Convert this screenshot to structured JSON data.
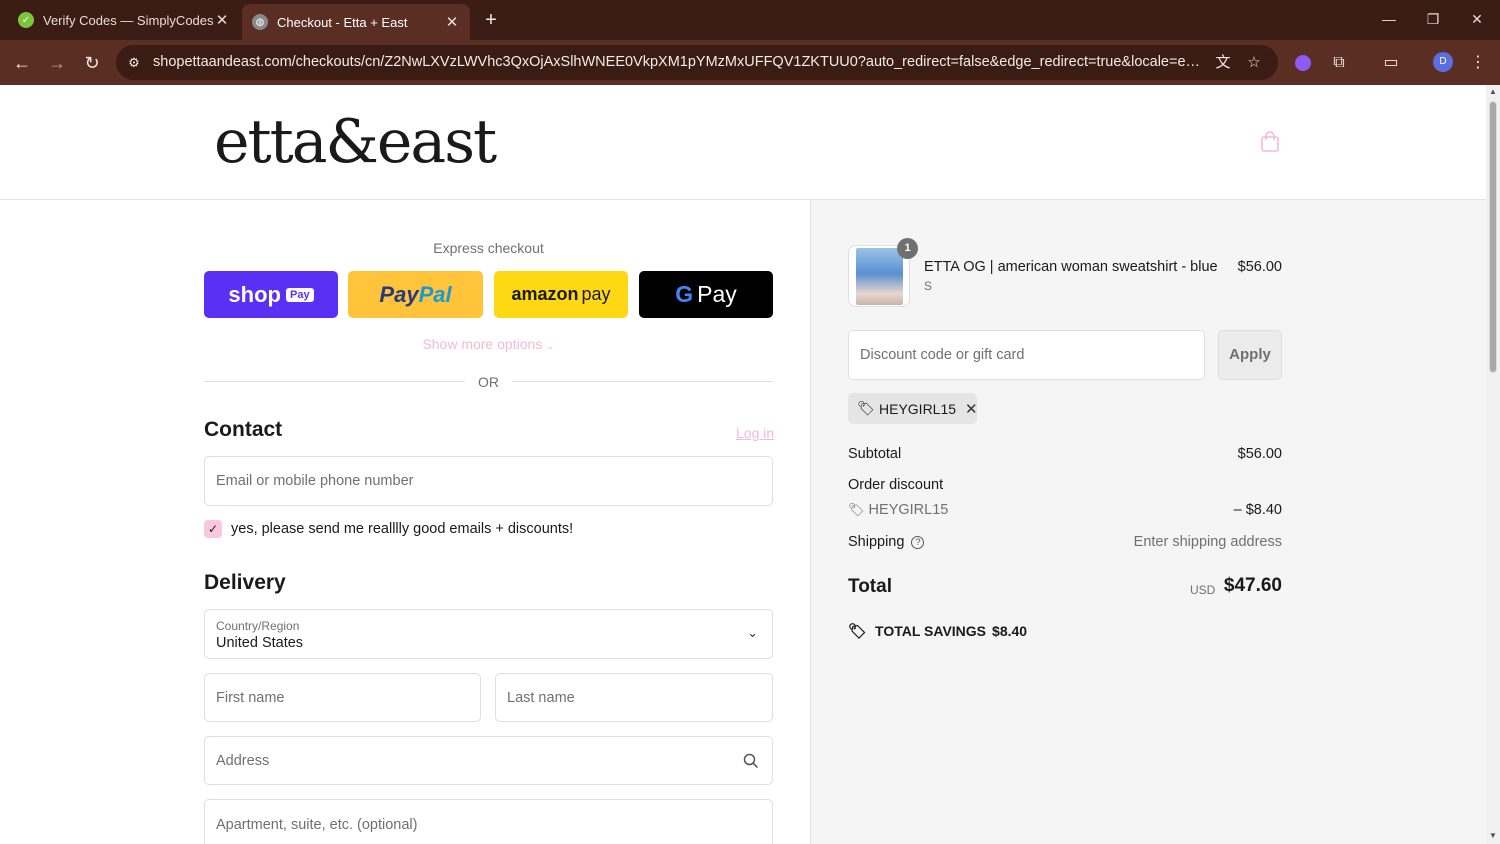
{
  "browser": {
    "tabs": [
      {
        "title": "Verify Codes — SimplyCodes",
        "favicon": "simplycodes-check-icon",
        "active": false
      },
      {
        "title": "Checkout - Etta + East",
        "favicon": "globe-icon",
        "active": true
      }
    ],
    "url": "shopettaandeast.com/checkouts/cn/Z2NwLXVzLWVhc3QxOjAxSlhWNEE0VkpXM1pYMzMxUFFQV1ZKTUU0?auto_redirect=false&edge_redirect=true&locale=en-US&skip_sh...",
    "profile_initial": "D",
    "theme_colors": {
      "tabbar": "#3b1c14",
      "toolbar": "#5a2e22"
    }
  },
  "store": {
    "logo_text": "etta&east"
  },
  "express": {
    "title": "Express checkout",
    "shop_pay": {
      "word": "shop",
      "badge": "Pay"
    },
    "paypal": {
      "part1": "Pay",
      "part2": "Pal"
    },
    "amazon": {
      "bold": "amazon",
      "rest": "pay"
    },
    "gpay": {
      "g": "G",
      "rest": "Pay"
    },
    "show_more": "Show more options",
    "or": "OR"
  },
  "contact": {
    "title": "Contact",
    "login": "Log in",
    "email_placeholder": "Email or mobile phone number",
    "marketing_label": "yes, please send me realllly good emails + discounts!",
    "marketing_checked": true
  },
  "delivery": {
    "title": "Delivery",
    "country_label": "Country/Region",
    "country_value": "United States",
    "first_name_placeholder": "First name",
    "last_name_placeholder": "Last name",
    "address_placeholder": "Address",
    "apartment_placeholder": "Apartment, suite, etc. (optional)"
  },
  "summary": {
    "item": {
      "quantity": "1",
      "name": "ETTA OG | american woman sweatshirt - blue",
      "variant": "S",
      "price": "$56.00"
    },
    "discount_placeholder": "Discount code or gift card",
    "apply_label": "Apply",
    "applied_code": "HEYGIRL15",
    "subtotal_label": "Subtotal",
    "subtotal_value": "$56.00",
    "order_discount_label": "Order discount",
    "order_discount_code": "HEYGIRL15",
    "order_discount_value": "– $8.40",
    "shipping_label": "Shipping",
    "shipping_value": "Enter shipping address",
    "total_label": "Total",
    "total_currency": "USD",
    "total_value": "$47.60",
    "savings_label": "TOTAL SAVINGS",
    "savings_value": "$8.40"
  },
  "colors": {
    "accent_pink": "#f4b9d6",
    "shop_pay": "#5a31f4",
    "paypal": "#ffc439",
    "amazon": "#ffd814",
    "gpay": "#000000"
  }
}
